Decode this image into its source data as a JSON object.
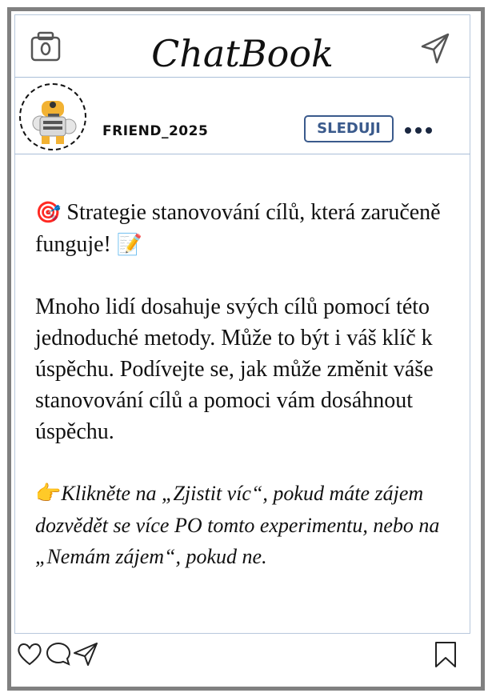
{
  "app": {
    "name": "ChatBook"
  },
  "icons": {
    "camera": "camera-icon",
    "send": "paper-plane-icon",
    "heart": "heart-icon",
    "comment": "comment-bubble-icon",
    "share": "paper-plane-icon",
    "bookmark": "bookmark-icon",
    "more": "more-dots-icon",
    "target": "🎯",
    "memo": "📝",
    "pointing": "👉"
  },
  "profile": {
    "username": "FRIEND_2025",
    "follow_label": "SLEDUJI"
  },
  "post": {
    "headline": "Strategie stanovování cílů, která zaručeně funguje!",
    "body": "Mnoho lidí dosahuje svých cílů pomocí této jednoduché metody. Může to být i váš klíč k úspěchu. Podívejte se, jak může změnit váše stanovování cílů a pomoci vám dosáhnout úspěchu.",
    "cta": "Klikněte na „Zjistit víc“, pokud máte zájem dozvědět se více PO tomto experimentu, nebo na „Nemám zájem“, pokud ne."
  },
  "colors": {
    "frame": "#808080",
    "divider": "#a9bfd8",
    "follow_border": "#3a5a8c",
    "accent_dots": "#1a2740"
  }
}
